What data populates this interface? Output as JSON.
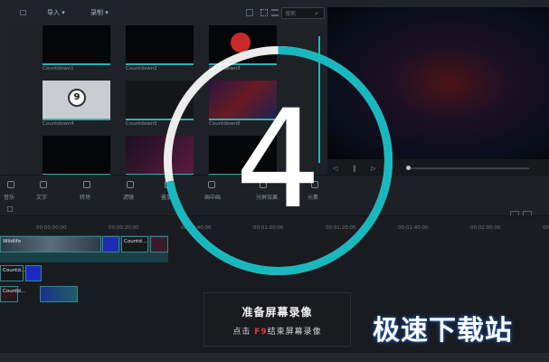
{
  "toolbar": {
    "import_label": "导入",
    "record_label": "录制",
    "search_placeholder": "搜索"
  },
  "media": {
    "items": [
      {
        "label": "Countdown1"
      },
      {
        "label": "Countdown2"
      },
      {
        "label": "Countdown3"
      },
      {
        "label": "Countdown4"
      },
      {
        "label": "Countdown5"
      },
      {
        "label": "Countdown6"
      }
    ],
    "thumb_digit": "9"
  },
  "tools": [
    {
      "label": "音乐"
    },
    {
      "label": "文字"
    },
    {
      "label": "转场"
    },
    {
      "label": "滤镜"
    },
    {
      "label": "叠加"
    },
    {
      "label": "画中画"
    },
    {
      "label": "分屏效果"
    },
    {
      "label": "元素"
    }
  ],
  "ruler": [
    "00:00:00:00",
    "00:00:20:00",
    "00:00:40:00",
    "00:01:00:00",
    "00:01:20:00",
    "00:01:40:00",
    "00:02:00:00",
    "00:02:20:00"
  ],
  "clips": [
    {
      "label": "Wildlife"
    },
    {
      "label": "Countd..."
    },
    {
      "label": "Countd..."
    },
    {
      "label": "Countd..."
    },
    {
      "label": "Countd..."
    }
  ],
  "countdown": {
    "number": "4",
    "progress": 0.72,
    "ring_color": "#18b9be"
  },
  "message": {
    "title": "准备屏幕录像",
    "line_pre": "点击",
    "key": "F9",
    "line_post": "结束屏幕录像"
  },
  "watermark": "极速下载站"
}
